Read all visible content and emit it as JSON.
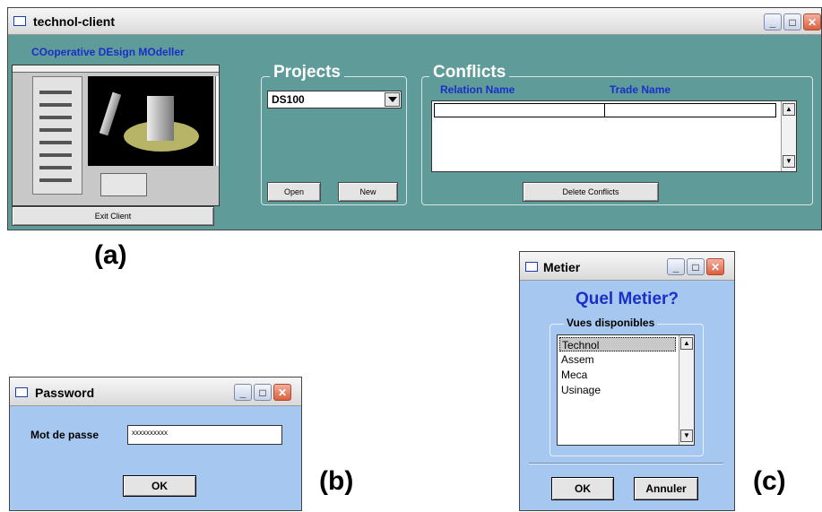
{
  "main_window": {
    "title": "technol-client",
    "app_name": "COoperative DEsign MOdeller",
    "exit_button": "Exit Client",
    "projects": {
      "legend": "Projects",
      "selected": "DS100",
      "open_button": "Open",
      "new_button": "New"
    },
    "conflicts": {
      "legend": "Conflicts",
      "columns": [
        "Relation Name",
        "Trade Name"
      ],
      "delete_button": "Delete Conflicts"
    }
  },
  "labels": {
    "a": "(a)",
    "b": "(b)",
    "c": "(c)"
  },
  "password_window": {
    "title": "Password",
    "field_label": "Mot de passe",
    "field_value": "xxxxxxxxxx",
    "ok_button": "OK"
  },
  "metier_window": {
    "title": "Metier",
    "heading": "Quel Metier?",
    "group_label": "Vues disponibles",
    "items": [
      "Technol",
      "Assem",
      "Meca",
      "Usinage"
    ],
    "selected_item": "Technol",
    "ok_button": "OK",
    "cancel_button": "Annuler"
  },
  "colors": {
    "main_bg": "#5f9c99",
    "dialog_bg": "#a6c8f0",
    "title_blue": "#1a2ec8"
  },
  "window_controls": {
    "minimize": "_",
    "maximize": "□",
    "close": "✕"
  }
}
